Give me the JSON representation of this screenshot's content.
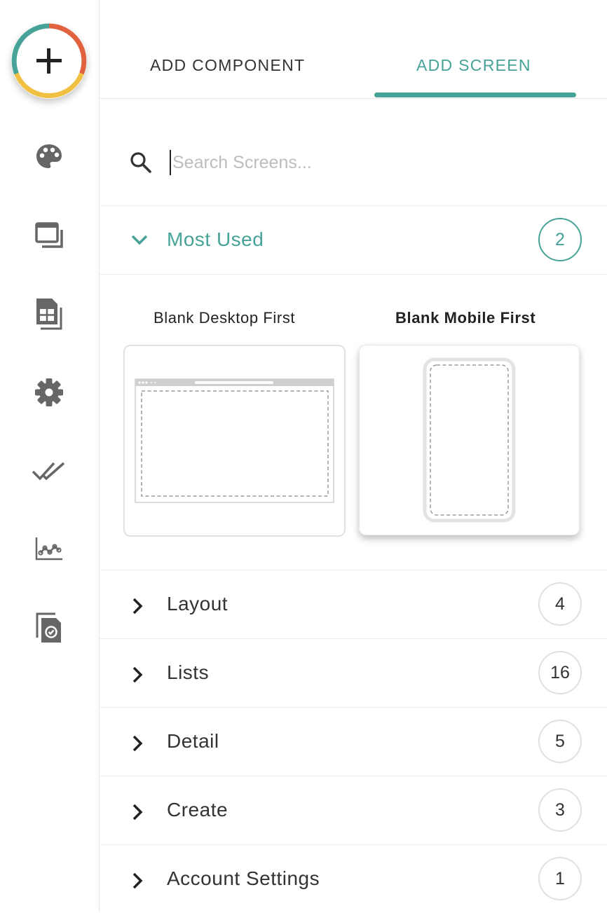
{
  "tabs": {
    "add_component": "ADD COMPONENT",
    "add_screen": "ADD SCREEN"
  },
  "search": {
    "placeholder": "Search Screens..."
  },
  "rail": {
    "icons": [
      "add-icon",
      "palette-icon",
      "screens-icon",
      "database-icon",
      "settings-icon",
      "checklist-icon",
      "analytics-icon",
      "publish-icon"
    ]
  },
  "most_used": {
    "label": "Most Used",
    "count": "2",
    "templates": [
      {
        "label": "Blank Desktop First"
      },
      {
        "label": "Blank Mobile First"
      }
    ]
  },
  "categories": [
    {
      "label": "Layout",
      "count": "4"
    },
    {
      "label": "Lists",
      "count": "16"
    },
    {
      "label": "Detail",
      "count": "5"
    },
    {
      "label": "Create",
      "count": "3"
    },
    {
      "label": "Account Settings",
      "count": "1"
    }
  ],
  "colors": {
    "accent": "#47a397",
    "fab_ring": [
      "#47a397",
      "#e0623f",
      "#f0c042"
    ],
    "icon": "#666666"
  }
}
